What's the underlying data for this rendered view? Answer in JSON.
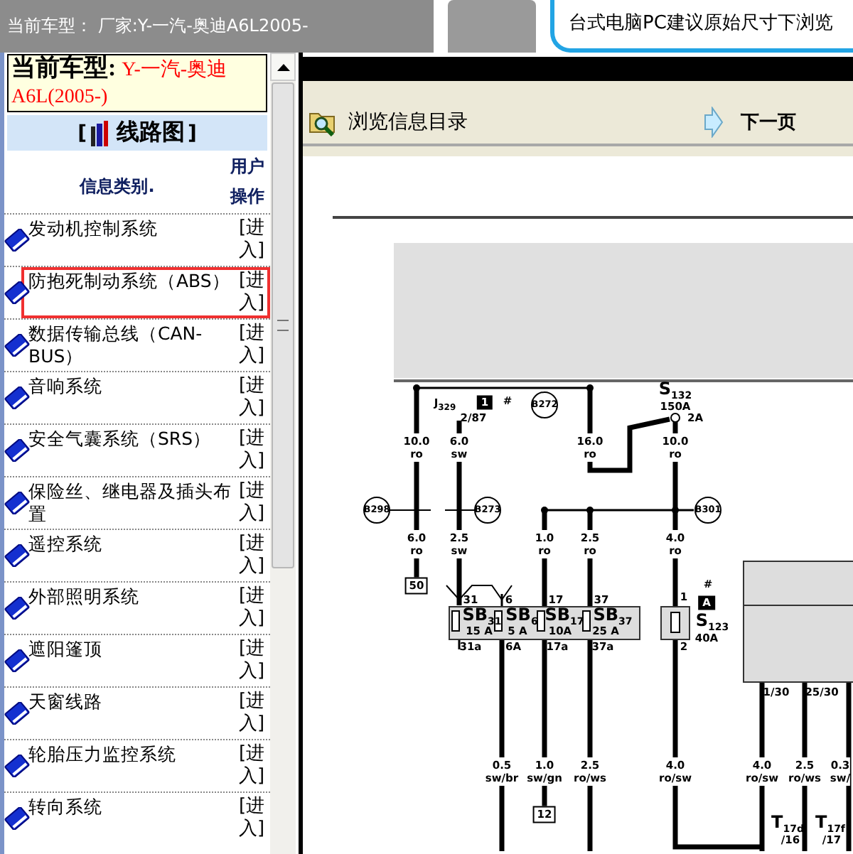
{
  "header": {
    "vehicle_text": "当前车型： 厂家:Y-一汽-奥迪A6L2005-",
    "banner": "台式电脑PC建议原始尺寸下浏览"
  },
  "sidebar": {
    "vehicle_label": "当前车型:",
    "vehicle_value": "Y-一汽-奥迪A6L(2005-)",
    "bracket_open": "[",
    "section_title": "线路图",
    "bracket_close": "]",
    "col_category": "信息类别.",
    "col_action": "用户操作",
    "items": [
      {
        "label": "发动机控制系统",
        "action": "[进入]",
        "selected": false
      },
      {
        "label": "防抱死制动系统（ABS）",
        "action": "[进入]",
        "selected": true
      },
      {
        "label": "数据传输总线（CAN-BUS）",
        "action": "[进入]",
        "selected": false
      },
      {
        "label": "音响系统",
        "action": "[进入]",
        "selected": false
      },
      {
        "label": "安全气囊系统（SRS）",
        "action": "[进入]",
        "selected": false
      },
      {
        "label": "保险丝、继电器及插头布置",
        "action": "[进入]",
        "selected": false
      },
      {
        "label": "遥控系统",
        "action": "[进入]",
        "selected": false
      },
      {
        "label": "外部照明系统",
        "action": "[进入]",
        "selected": false
      },
      {
        "label": "遮阳篷顶",
        "action": "[进入]",
        "selected": false
      },
      {
        "label": "天窗线路",
        "action": "[进入]",
        "selected": false
      },
      {
        "label": "轮胎压力监控系统",
        "action": "[进入]",
        "selected": false
      },
      {
        "label": "转向系统",
        "action": "[进入]",
        "selected": false
      }
    ]
  },
  "content": {
    "toolbar": {
      "catalog": "浏览信息目录",
      "next": "下一页"
    },
    "diagram": {
      "labels": [
        {
          "kind": "text",
          "text": "J$_{329}$"
        },
        {
          "kind": "dark-box",
          "text": "1"
        },
        {
          "kind": "text",
          "text": "#"
        },
        {
          "kind": "text",
          "text": "2/87"
        },
        {
          "kind": "circle",
          "text": "B272"
        },
        {
          "kind": "big",
          "text": "S$_{132}$"
        },
        {
          "kind": "text",
          "text": "150A"
        },
        {
          "kind": "text",
          "text": "2A"
        },
        {
          "kind": "wire",
          "size": "10.0",
          "code": "ro"
        },
        {
          "kind": "wire",
          "size": "6.0",
          "code": "sw"
        },
        {
          "kind": "wire",
          "size": "16.0",
          "code": "ro"
        },
        {
          "kind": "wire",
          "size": "10.0",
          "code": "ro"
        },
        {
          "kind": "circle",
          "text": "B298"
        },
        {
          "kind": "circle",
          "text": "B273"
        },
        {
          "kind": "circle",
          "text": "B301"
        },
        {
          "kind": "wire",
          "size": "6.0",
          "code": "ro"
        },
        {
          "kind": "wire",
          "size": "2.5",
          "code": "sw"
        },
        {
          "kind": "wire",
          "size": "1.0",
          "code": "ro"
        },
        {
          "kind": "wire",
          "size": "2.5",
          "code": "ro"
        },
        {
          "kind": "wire",
          "size": "4.0",
          "code": "ro"
        },
        {
          "kind": "box",
          "text": "50"
        },
        {
          "kind": "text",
          "text": "31"
        },
        {
          "kind": "text",
          "text": "6"
        },
        {
          "kind": "text",
          "text": "17"
        },
        {
          "kind": "text",
          "text": "37"
        },
        {
          "kind": "text",
          "text": "1"
        },
        {
          "kind": "text",
          "text": "#"
        },
        {
          "kind": "dark-box",
          "text": "A"
        },
        {
          "kind": "big",
          "text": "SB$_{31}$"
        },
        {
          "kind": "big",
          "text": "SB$_{6}$"
        },
        {
          "kind": "big",
          "text": "SB$_{17}$"
        },
        {
          "kind": "big",
          "text": "SB$_{37}$"
        },
        {
          "kind": "text",
          "text": "15 A"
        },
        {
          "kind": "text",
          "text": "5 A"
        },
        {
          "kind": "text",
          "text": "10A"
        },
        {
          "kind": "text",
          "text": "25 A"
        },
        {
          "kind": "big",
          "text": "S$_{123}$"
        },
        {
          "kind": "text",
          "text": "40A"
        },
        {
          "kind": "text",
          "text": "31a"
        },
        {
          "kind": "text",
          "text": "6A"
        },
        {
          "kind": "text",
          "text": "17a"
        },
        {
          "kind": "text",
          "text": "37a"
        },
        {
          "kind": "text",
          "text": "2"
        },
        {
          "kind": "text",
          "text": "1/30"
        },
        {
          "kind": "text",
          "text": "25/30"
        },
        {
          "kind": "wire",
          "size": "0.5",
          "code": "sw/br"
        },
        {
          "kind": "wire",
          "size": "1.0",
          "code": "sw/gn"
        },
        {
          "kind": "wire",
          "size": "2.5",
          "code": "ro/ws"
        },
        {
          "kind": "wire",
          "size": "4.0",
          "code": "ro/sw"
        },
        {
          "kind": "wire",
          "size": "4.0",
          "code": "ro/sw"
        },
        {
          "kind": "wire",
          "size": "2.5",
          "code": "ro/ws"
        },
        {
          "kind": "wire",
          "size": "0.3",
          "code": "sw/"
        },
        {
          "kind": "box",
          "text": "12"
        },
        {
          "kind": "big",
          "text": "T$_{17d}$"
        },
        {
          "kind": "text",
          "text": "/16"
        },
        {
          "kind": "big",
          "text": "T$_{17f}$"
        },
        {
          "kind": "text",
          "text": "/17"
        }
      ]
    }
  }
}
